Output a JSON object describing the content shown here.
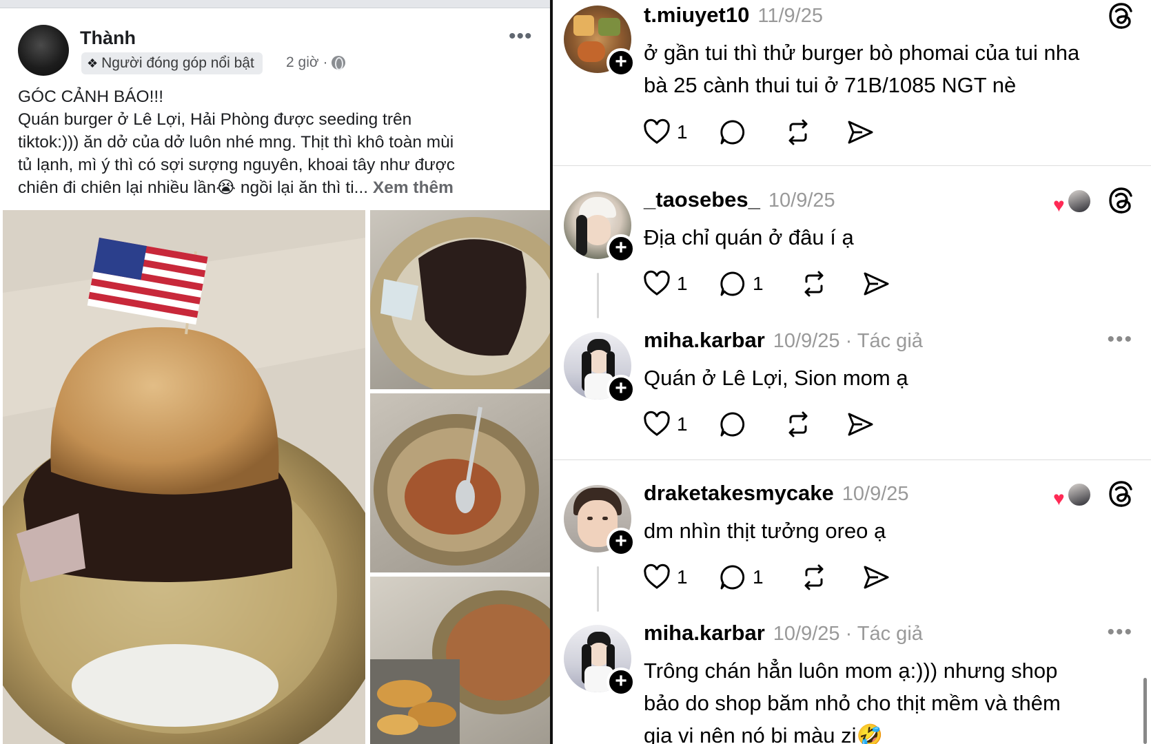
{
  "facebook_post": {
    "author": "Thành",
    "badge": "Người đóng góp nổi bật",
    "time": "2 giờ ·",
    "more": "•••",
    "lines": [
      "GÓC CẢNH BÁO!!!",
      "Quán burger ở Lê Lợi, Hải Phòng được seeding trên",
      "tiktok:))) ăn dở của dở luôn nhé mng. Thịt thì khô toàn mùi",
      "tủ lạnh, mì ý thì có sợi sượng nguyên, khoai tây như được",
      "chiên đi chiên lại nhiều lần😭 ngồi lại ăn thì ti..."
    ],
    "see_more": "Xem thêm"
  },
  "threads": {
    "replies": [
      {
        "username": "t.miuyet10",
        "date": "11/9/25",
        "author_tag": "",
        "lines": [
          "ở gần tui thì thử burger bò phomai của tui nha",
          "bà 25 cành thui tui ở 71B/1085 NGT nè"
        ],
        "likes": "1",
        "comments": "",
        "corner": "threads-logo"
      },
      {
        "username": "_taosebes_",
        "date": "10/9/25",
        "author_tag": "",
        "lines": [
          "Địa chỉ quán ở đâu í ạ"
        ],
        "likes": "1",
        "comments": "1",
        "corner": "threads-logo"
      },
      {
        "username": "miha.karbar",
        "date": "10/9/25",
        "author_tag": "· Tác giả",
        "lines": [
          "Quán ở Lê Lợi, Sion mom ạ"
        ],
        "likes": "1",
        "comments": "",
        "corner": "more-dots"
      },
      {
        "username": "draketakesmycake",
        "date": "10/9/25",
        "author_tag": "",
        "lines": [
          "dm nhìn thịt tưởng oreo ạ"
        ],
        "likes": "1",
        "comments": "1",
        "corner": "threads-logo"
      },
      {
        "username": "miha.karbar",
        "date": "10/9/25",
        "author_tag": "· Tác giả",
        "lines": [
          "Trông chán hẳn luôn mom ạ:))) nhưng shop",
          "bảo do shop băm nhỏ cho thịt mềm và thêm",
          "gia vị nên nó bị màu zi🤣"
        ],
        "likes": "",
        "comments": "",
        "corner": "more-dots"
      }
    ],
    "more_dots": "•••",
    "plus": "+",
    "colors": {
      "heart": "#ff2a55",
      "date": "#999999",
      "text": "#000000"
    }
  }
}
